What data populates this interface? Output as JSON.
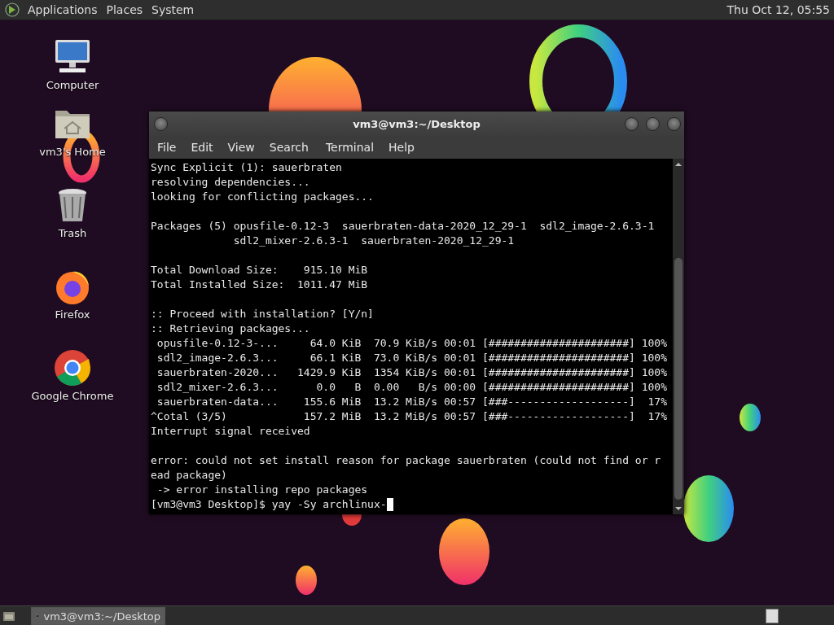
{
  "top_panel": {
    "menus": [
      "Applications",
      "Places",
      "System"
    ],
    "clock": "Thu Oct 12, 05:55"
  },
  "desktop_icons": [
    {
      "label": "Computer",
      "kind": "computer"
    },
    {
      "label": "vm3's Home",
      "kind": "home"
    },
    {
      "label": "Trash",
      "kind": "trash"
    },
    {
      "label": "Firefox",
      "kind": "firefox"
    },
    {
      "label": "Google Chrome",
      "kind": "chrome"
    }
  ],
  "terminal": {
    "title": "vm3@vm3:~/Desktop",
    "menu": [
      "File",
      "Edit",
      "View",
      "Search",
      "Terminal",
      "Help"
    ],
    "blocks": [
      [
        "Sync Explicit (1): sauerbraten",
        "resolving dependencies...",
        "looking for conflicting packages..."
      ],
      [
        "Packages (5) opusfile-0.12-3  sauerbraten-data-2020_12_29-1  sdl2_image-2.6.3-1",
        "             sdl2_mixer-2.6.3-1  sauerbraten-2020_12_29-1"
      ],
      [
        "Total Download Size:    915.10 MiB",
        "Total Installed Size:  1011.47 MiB"
      ],
      [
        ":: Proceed with installation? [Y/n]",
        ":: Retrieving packages...",
        " opusfile-0.12-3-...     64.0 KiB  70.9 KiB/s 00:01 [######################] 100%",
        " sdl2_image-2.6.3...     66.1 KiB  73.0 KiB/s 00:01 [######################] 100%",
        " sauerbraten-2020...   1429.9 KiB  1354 KiB/s 00:01 [######################] 100%",
        " sdl2_mixer-2.6.3...      0.0   B  0.00   B/s 00:00 [######################] 100%",
        " sauerbraten-data...    155.6 MiB  13.2 MiB/s 00:57 [###-------------------]  17%",
        "^Cotal (3/5)            157.2 MiB  13.2 MiB/s 00:57 [###-------------------]  17%",
        "Interrupt signal received"
      ],
      [
        "error: could not set install reason for package sauerbraten (could not find or r",
        "ead package)",
        " -> error installing repo packages"
      ]
    ],
    "prompt": "[vm3@vm3 Desktop]$ yay -Sy archlinux-"
  },
  "taskbar": {
    "tasks": [
      {
        "label": "vm3@vm3:~/Desktop",
        "selected": true
      }
    ]
  }
}
